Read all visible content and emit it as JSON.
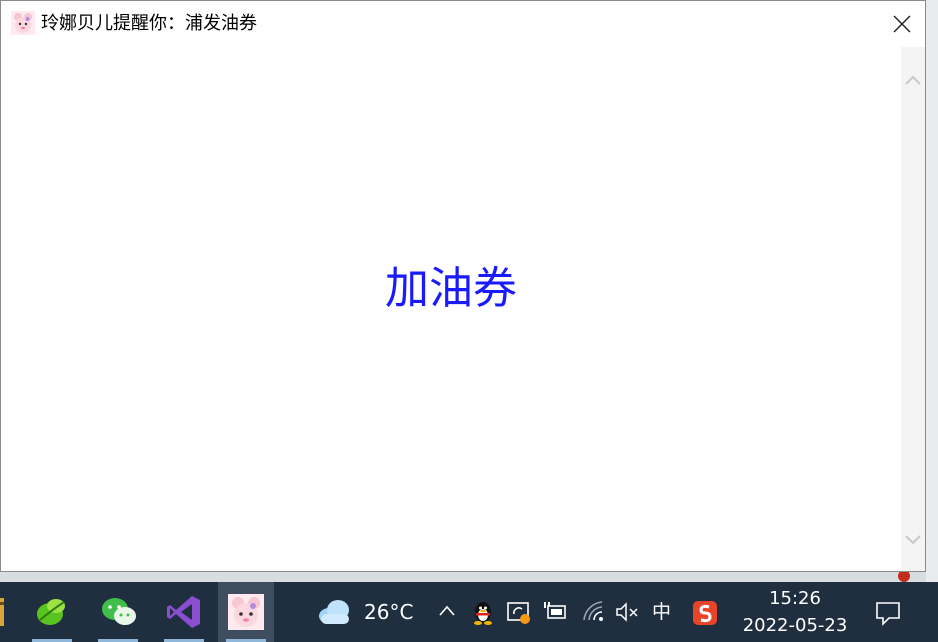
{
  "window": {
    "title": "玲娜贝儿提醒你：浦发油券",
    "close_icon": "close-icon",
    "app_icon": "linabell-icon"
  },
  "content": {
    "message": "加油券",
    "message_color": "#1a1aff"
  },
  "scrollbar": {
    "up_icon": "chevron-up-icon",
    "down_icon": "chevron-down-icon"
  },
  "taskbar": {
    "apps": [
      {
        "name": "unknown-app",
        "icon": "partial-app-icon"
      },
      {
        "name": "leaf-app",
        "icon": "green-leaf-icon"
      },
      {
        "name": "wechat",
        "icon": "wechat-icon"
      },
      {
        "name": "visual-studio",
        "icon": "visual-studio-icon"
      },
      {
        "name": "linabell-reminder",
        "icon": "linabell-icon",
        "active": true
      }
    ],
    "weather": {
      "icon": "cloud-icon",
      "temperature": "26°C"
    },
    "tray": {
      "show_hidden_icon": "chevron-up-icon",
      "qq_icon": "qq-penguin-icon",
      "sync_icon": "sync-status-icon",
      "power_icon": "battery-plug-icon",
      "wifi_icon": "wifi-icon",
      "volume_icon": "volume-muted-icon",
      "ime": "中",
      "sogou_icon": "sogou-s-icon"
    },
    "clock": {
      "time": "15:26",
      "date": "2022-05-23"
    },
    "notification_icon": "action-center-icon"
  },
  "colors": {
    "taskbar_bg": "#1f2f40",
    "accent_underline": "#8fb6db",
    "sogou_red": "#e8442a"
  }
}
